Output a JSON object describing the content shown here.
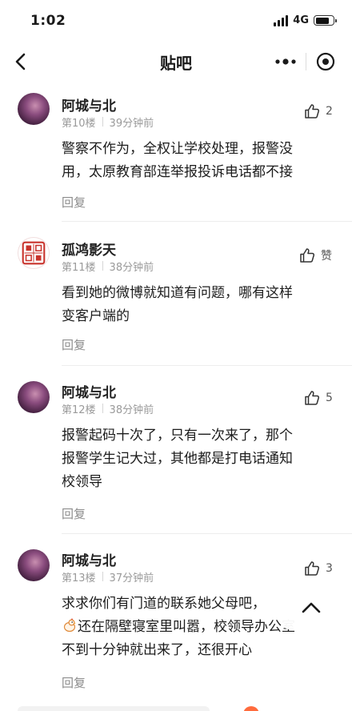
{
  "status_bar": {
    "time": "1:02",
    "network": "4G"
  },
  "nav": {
    "title": "贴吧"
  },
  "comments": [
    {
      "username": "阿城与北",
      "floor": "第10楼",
      "time": "39分钟前",
      "like": "2",
      "content": [
        "警察不作为，全权让学校处理，报警没",
        "用，太原教育部连举报投诉电话都不接"
      ],
      "reply": "回复",
      "avatar": "purple"
    },
    {
      "username": "孤鸿影天",
      "floor": "第11楼",
      "time": "38分钟前",
      "like": "赞",
      "content": [
        "看到她的微博就知道有问题，哪有这样",
        "变客户端的"
      ],
      "reply": "回复",
      "avatar": "seal"
    },
    {
      "username": "阿城与北",
      "floor": "第12楼",
      "time": "38分钟前",
      "like": "5",
      "content": [
        "报警起码十次了，只有一次来了，那个",
        "报警学生记大过，其他都是打电话通知",
        "校领导"
      ],
      "reply": "回复",
      "avatar": "purple"
    },
    {
      "username": "阿城与北",
      "floor": "第13楼",
      "time": "37分钟前",
      "like": "3",
      "content": [
        "求求你们有门道的联系她父母吧，",
        "还在隔壁寝室里叫嚣，校领导办公室",
        "不到十分钟就出来了，还很开心"
      ],
      "reply": "回复",
      "avatar": "purple"
    }
  ]
}
